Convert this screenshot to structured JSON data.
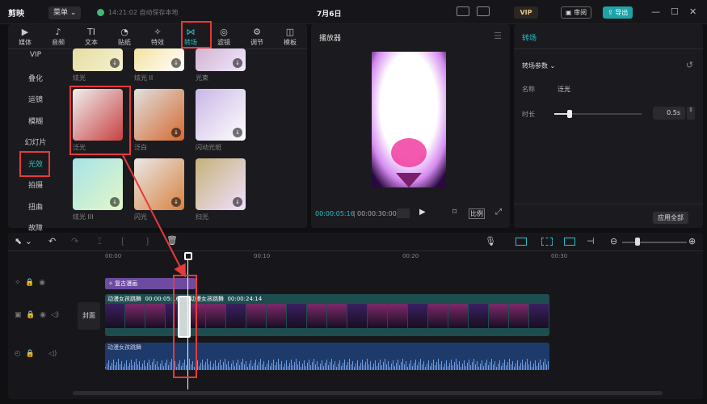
{
  "app": {
    "logo": "剪映",
    "menu": "菜单",
    "save_status": "14:21:02 自动保存本地",
    "date": "7月6日",
    "vip": "VIP",
    "review": "审阅",
    "export": "导出"
  },
  "categories": [
    {
      "label": "媒体",
      "icon": "▶"
    },
    {
      "label": "音频",
      "icon": "♪"
    },
    {
      "label": "文本",
      "icon": "TI"
    },
    {
      "label": "贴纸",
      "icon": "◔"
    },
    {
      "label": "特效",
      "icon": "✧"
    },
    {
      "label": "转场",
      "icon": "⋈"
    },
    {
      "label": "滤镜",
      "icon": "◎"
    },
    {
      "label": "调节",
      "icon": "⚙"
    },
    {
      "label": "模板",
      "icon": "◫"
    }
  ],
  "sidebar": [
    "VIP",
    "叠化",
    "运镜",
    "模糊",
    "幻灯片",
    "光效",
    "拍摄",
    "扭曲",
    "故障"
  ],
  "thumbs_top": [
    {
      "label": "炫光"
    },
    {
      "label": "炫光 II"
    },
    {
      "label": "光束"
    }
  ],
  "thumbs_mid": [
    {
      "label": "泛光"
    },
    {
      "label": "泛白"
    },
    {
      "label": "闪动光斑"
    }
  ],
  "thumbs_bot": [
    {
      "label": "炫光 III"
    },
    {
      "label": "闪光"
    },
    {
      "label": "扫光"
    }
  ],
  "player": {
    "title": "播放器",
    "current": "00:00:05:16",
    "total": "00:00:30:00",
    "ratio": "比例"
  },
  "props": {
    "title": "转场",
    "section": "转场参数",
    "name_label": "名称",
    "name_value": "泛光",
    "duration_label": "时长",
    "duration_value": "0.5s",
    "apply_all": "应用全部"
  },
  "timeline": {
    "ticks": [
      "00:00",
      "00:10",
      "00:20",
      "00:30"
    ],
    "effect_clip": "复古漫画",
    "video_clip": "动漫女孩跳舞",
    "video_time1": "00:00:05:16",
    "video_clip2": "动漫女孩跳舞",
    "video_time2": "00:00:24:14",
    "audio_clip": "动漫女孩跳舞",
    "cover": "封面"
  }
}
